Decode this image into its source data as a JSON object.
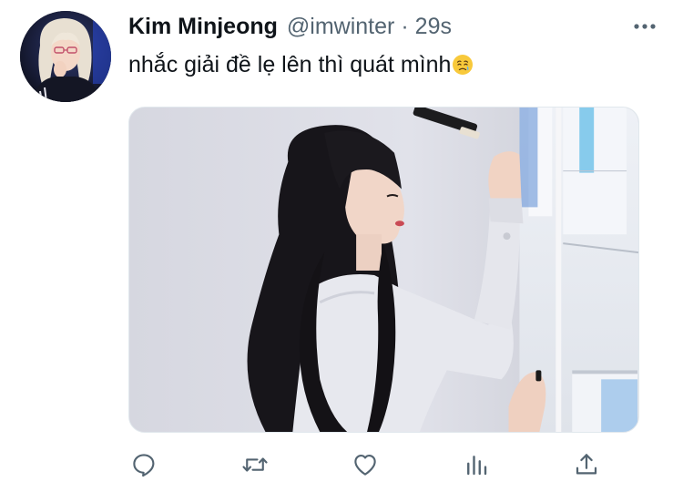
{
  "tweet": {
    "display_name": "Kim Minjeong",
    "handle": "@imwinter",
    "separator": "·",
    "time": "29s",
    "text": "nhắc giải đề lẹ lên thì quát mình",
    "text_emoji": "sad-but-relieved-face-emoji",
    "media": {
      "alt_subject": "photo"
    }
  },
  "actions": {
    "reply": "reply-icon",
    "retweet": "retweet-icon",
    "like": "like-icon",
    "analytics": "analytics-icon",
    "share": "share-icon"
  },
  "colors": {
    "text_primary": "#0f1419",
    "text_secondary": "#536471",
    "icon": "#536471",
    "media_border": "#e1e8ed",
    "background": "#ffffff"
  }
}
